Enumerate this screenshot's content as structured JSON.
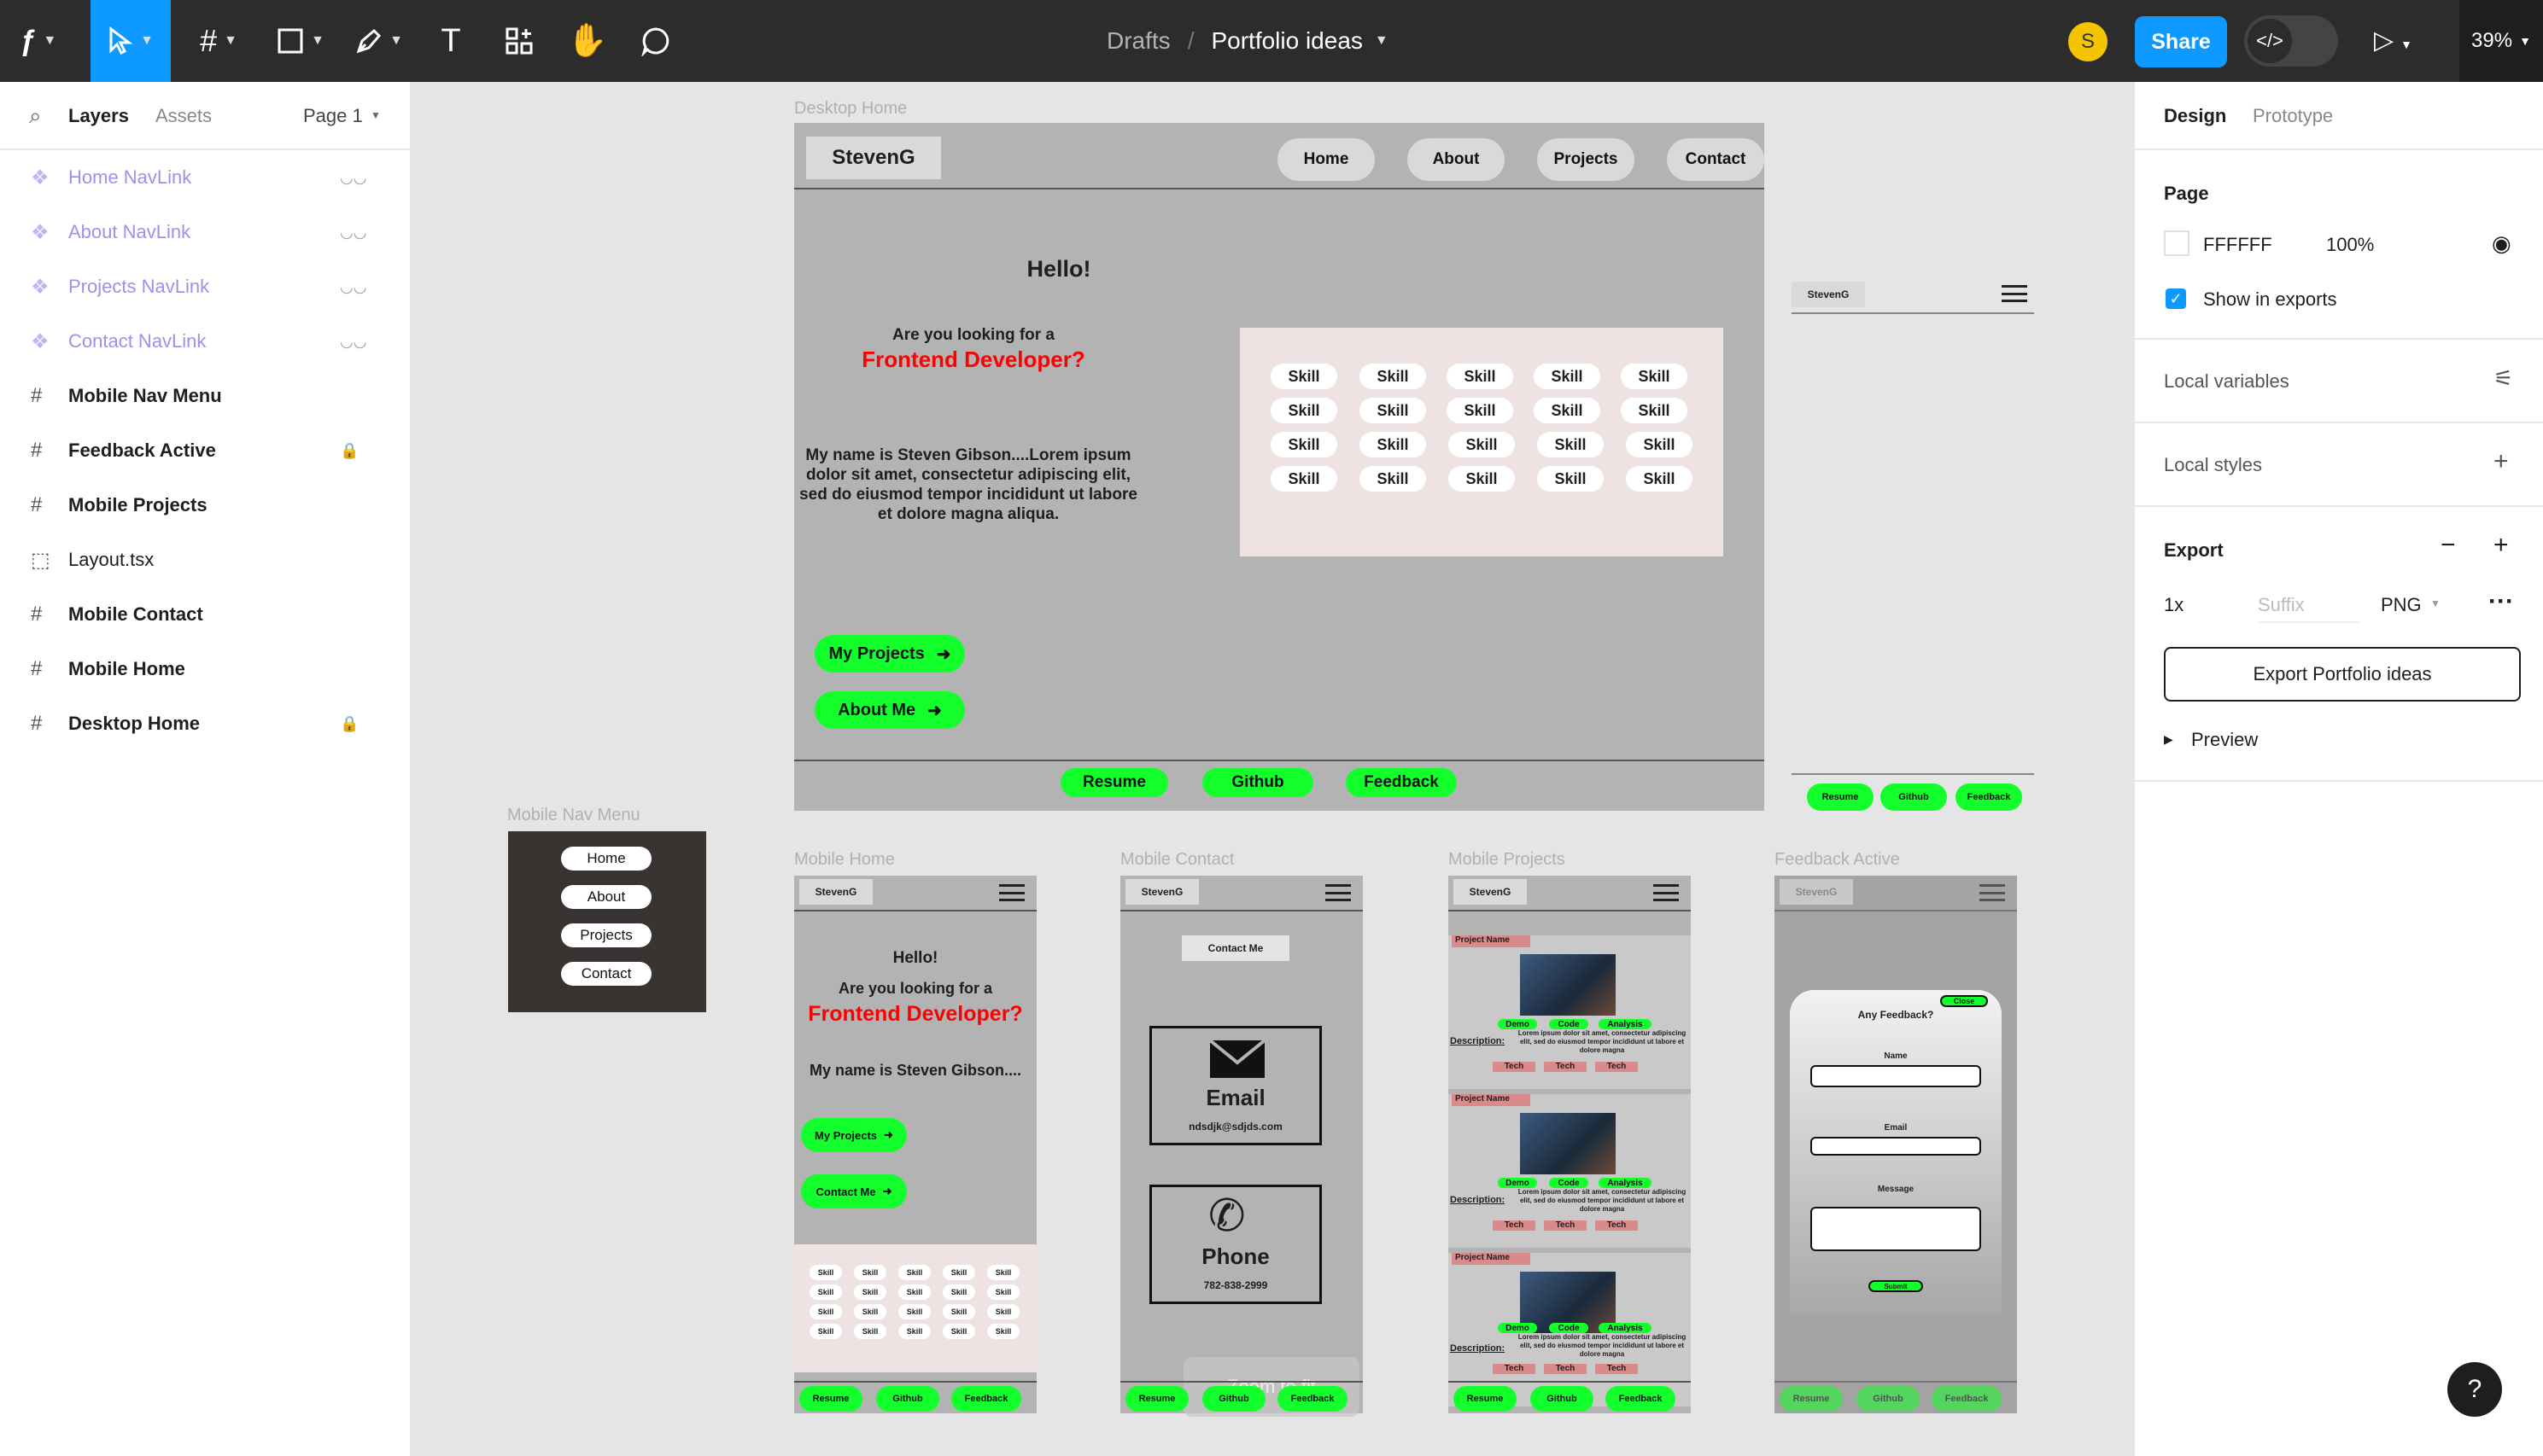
{
  "toolbar": {
    "tools": [
      "main-menu",
      "move",
      "frame",
      "rectangle",
      "pen",
      "text",
      "resources",
      "hand",
      "comment"
    ],
    "breadcrumb_parent": "Drafts",
    "breadcrumb_sep": "/",
    "file_name": "Portfolio ideas",
    "avatar_initial": "S",
    "share_label": "Share",
    "zoom_label": "39%"
  },
  "left_panel": {
    "tab_layers": "Layers",
    "tab_assets": "Assets",
    "page_selector": "Page 1",
    "layers": [
      {
        "name": "Home NavLink",
        "kind": "component"
      },
      {
        "name": "About NavLink",
        "kind": "component"
      },
      {
        "name": "Projects NavLink",
        "kind": "component"
      },
      {
        "name": "Contact NavLink",
        "kind": "component"
      },
      {
        "name": "Mobile Nav Menu",
        "kind": "frame"
      },
      {
        "name": "Feedback Active",
        "kind": "frame",
        "locked": true
      },
      {
        "name": "Mobile Projects",
        "kind": "frame"
      },
      {
        "name": "Layout.tsx",
        "kind": "code"
      },
      {
        "name": "Mobile Contact",
        "kind": "frame"
      },
      {
        "name": "Mobile Home",
        "kind": "frame"
      },
      {
        "name": "Desktop Home",
        "kind": "frame",
        "locked": true
      }
    ]
  },
  "canvas": {
    "desktop": {
      "label": "Desktop Home",
      "logo": "StevenG",
      "nav": [
        "Home",
        "About",
        "Projects",
        "Contact"
      ],
      "hello": "Hello!",
      "looking": "Are you looking for a",
      "role": "Frontend Developer?",
      "bio": "My name is Steven Gibson....Lorem ipsum dolor sit amet, consectetur adipiscing elit, sed do eiusmod tempor incididunt ut labore et dolore magna aliqua.",
      "skill": "Skill",
      "btn_projects": "My Projects",
      "btn_about": "About Me",
      "footer": [
        "Resume",
        "Github",
        "Feedback"
      ]
    },
    "tablet": {
      "logo": "StevenG",
      "footer": [
        "Resume",
        "Github",
        "Feedback"
      ]
    },
    "mobile_nav": {
      "label": "Mobile Nav Menu",
      "items": [
        "Home",
        "About",
        "Projects",
        "Contact"
      ]
    },
    "mobile_home": {
      "label": "Mobile Home",
      "logo": "StevenG",
      "hello": "Hello!",
      "looking": "Are you looking for a",
      "role": "Frontend Developer?",
      "bio": "My name is Steven Gibson....",
      "btn_projects": "My Projects",
      "btn_contact": "Contact Me",
      "skill": "Skill",
      "footer": [
        "Resume",
        "Github",
        "Feedback"
      ]
    },
    "mobile_contact": {
      "label": "Mobile Contact",
      "logo": "StevenG",
      "contact_btn": "Contact Me",
      "email_title": "Email",
      "email_value": "ndsdjk@sdjds.com",
      "phone_title": "Phone",
      "phone_value": "782-838-2999",
      "footer": [
        "Resume",
        "Github",
        "Feedback"
      ],
      "zoom_hint": "Zoom to fit"
    },
    "mobile_projects": {
      "label": "Mobile Projects",
      "logo": "StevenG",
      "project_name": "Project Name",
      "tags": [
        "Demo",
        "Code",
        "Analysis"
      ],
      "desc_label": "Description:",
      "desc": "Lorem ipsum dolor sit amet, consectetur adipiscing elit, sed do eiusmod tempor incididunt ut labore et dolore magna",
      "tech": "Tech",
      "footer": [
        "Resume",
        "Github",
        "Feedback"
      ]
    },
    "feedback": {
      "label": "Feedback Active",
      "logo": "StevenG",
      "close": "Close",
      "title": "Any Feedback?",
      "name_label": "Name",
      "email_label": "Email",
      "message_label": "Message",
      "submit": "Submit",
      "footer": [
        "Resume",
        "Github",
        "Feedback"
      ]
    }
  },
  "right_panel": {
    "tab_design": "Design",
    "tab_prototype": "Prototype",
    "page_title": "Page",
    "page_color": "FFFFFF",
    "page_opacity": "100%",
    "show_exports": "Show in exports",
    "local_variables": "Local variables",
    "local_styles": "Local styles",
    "export_title": "Export",
    "export_scale": "1x",
    "export_suffix_placeholder": "Suffix",
    "export_format": "PNG",
    "export_button": "Export Portfolio ideas",
    "preview": "Preview"
  },
  "help": "?"
}
